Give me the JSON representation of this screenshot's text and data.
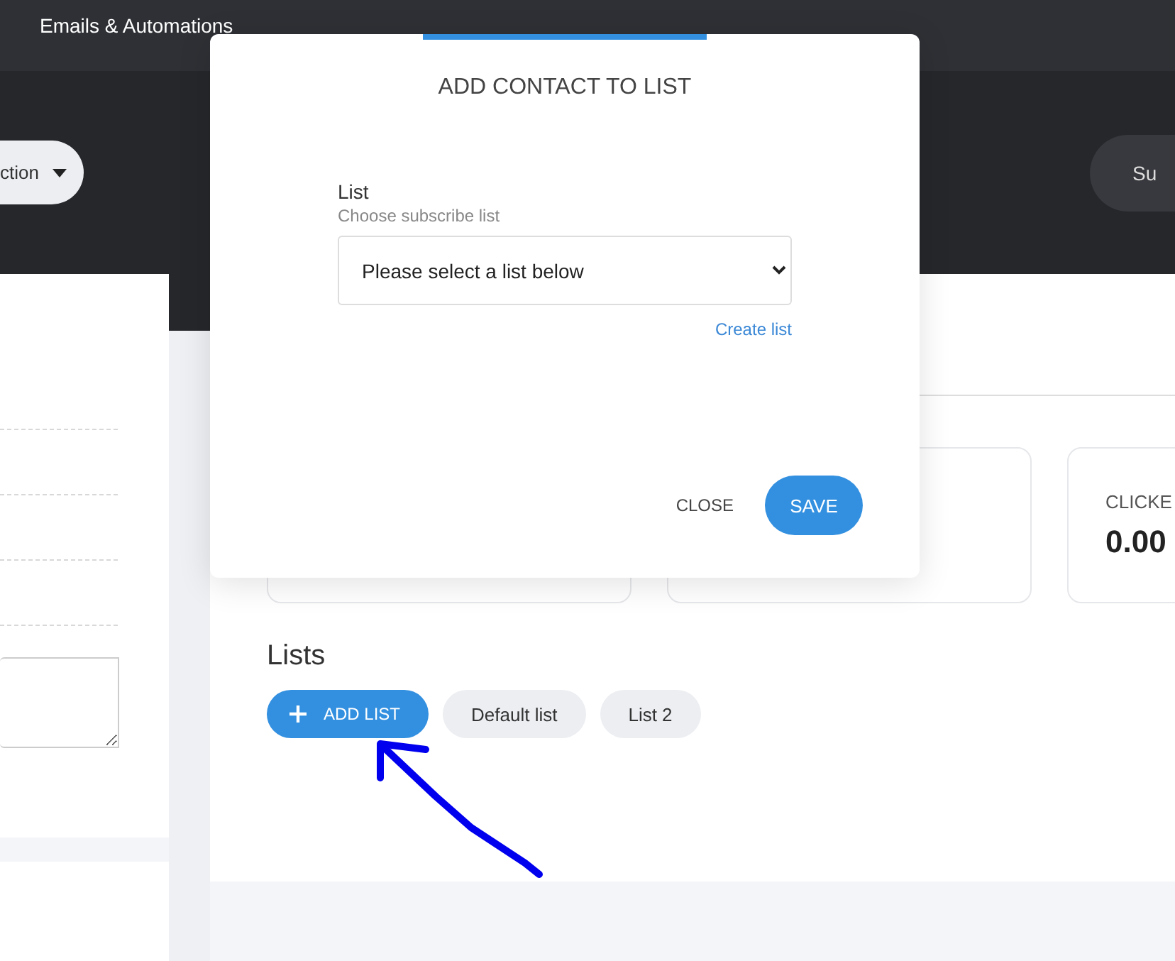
{
  "top_bar": {
    "title": "Emails & Automations"
  },
  "header": {
    "action_pill": "ction",
    "right_pill": "Su"
  },
  "stats": [
    {
      "label": "CLICKE",
      "value": "0.00"
    }
  ],
  "lists_section": {
    "title": "Lists",
    "add_button": "ADD LIST",
    "lists": [
      "Default list",
      "List 2"
    ]
  },
  "modal": {
    "title": "ADD CONTACT TO LIST",
    "field_label": "List",
    "field_hint": "Choose subscribe list",
    "select_value": "Please select a list below",
    "create_link": "Create list",
    "buttons": [
      {
        "label": "CLOSE",
        "kind": "text"
      },
      {
        "label": "SAVE",
        "kind": "primary"
      }
    ]
  }
}
